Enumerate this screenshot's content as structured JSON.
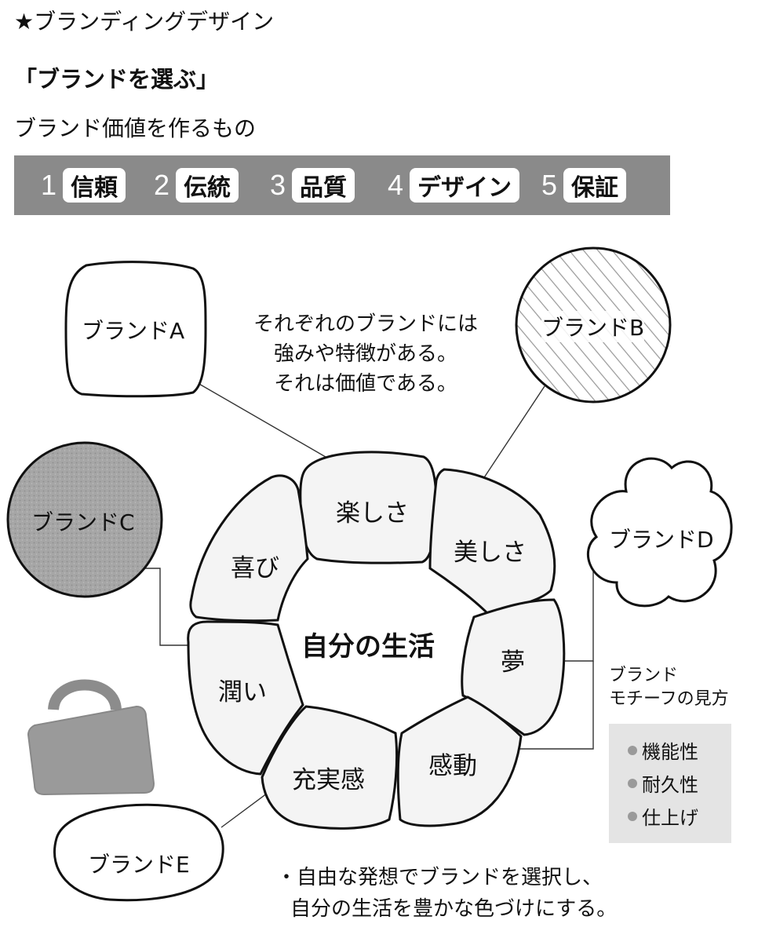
{
  "header": {
    "category": "★ブランディングデザイン",
    "title": "「ブランドを選ぶ」",
    "subtitle": "ブランド価値を作るもの"
  },
  "value_bar": [
    {
      "num": "1",
      "label": "信頼"
    },
    {
      "num": "2",
      "label": "伝統"
    },
    {
      "num": "3",
      "label": "品質"
    },
    {
      "num": "4",
      "label": "デザイン"
    },
    {
      "num": "5",
      "label": "保証"
    }
  ],
  "caption": [
    "それぞれのブランドには",
    "強みや特徴がある。",
    "それは価値である。"
  ],
  "brands": {
    "a": "ブランドA",
    "b": "ブランドB",
    "c": "ブランドC",
    "d": "ブランドD",
    "e": "ブランドE"
  },
  "center": "自分の生活",
  "ring": {
    "tanoshisa": "楽しさ",
    "utsukushisa": "美しさ",
    "yume": "夢",
    "kando": "感動",
    "jujitsukan": "充実感",
    "uruoi": "潤い",
    "yorokobi": "喜び"
  },
  "motif": {
    "heading": [
      "ブランド",
      "モチーフの見方"
    ],
    "items": [
      "機能性",
      "耐久性",
      "仕上げ"
    ]
  },
  "footer": [
    "・自由な発想でブランドを選択し、",
    "自分の生活を豊かな色づけにする。"
  ],
  "colors": {
    "bar": "#8a8a8a",
    "brand_c_fill": "#a6a6a6",
    "bag_fill": "#9a9a9a",
    "ring_fill": "#f2f2f2",
    "checklist_bg": "#e4e4e4"
  }
}
